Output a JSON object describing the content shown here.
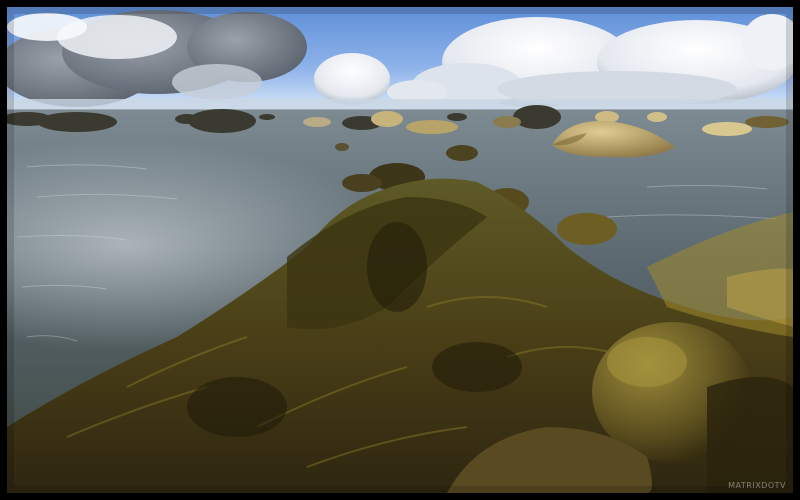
{
  "image": {
    "subject": "rocky-seashore",
    "watermark": "MATRIXDOTV",
    "colors": {
      "sky_top": "#5f8fd8",
      "sky_horizon": "#cfe0f6",
      "cloud": "#f1f3f7",
      "cloud_shadow": "#6d7480",
      "water_deep": "#4d5a63",
      "water_light": "#9aa7ae",
      "algae_dark": "#3a3114",
      "algae_mid": "#6f6320",
      "algae_light": "#b19a37",
      "rock_sunlit": "#c9b37a",
      "frame": "#000000"
    }
  }
}
